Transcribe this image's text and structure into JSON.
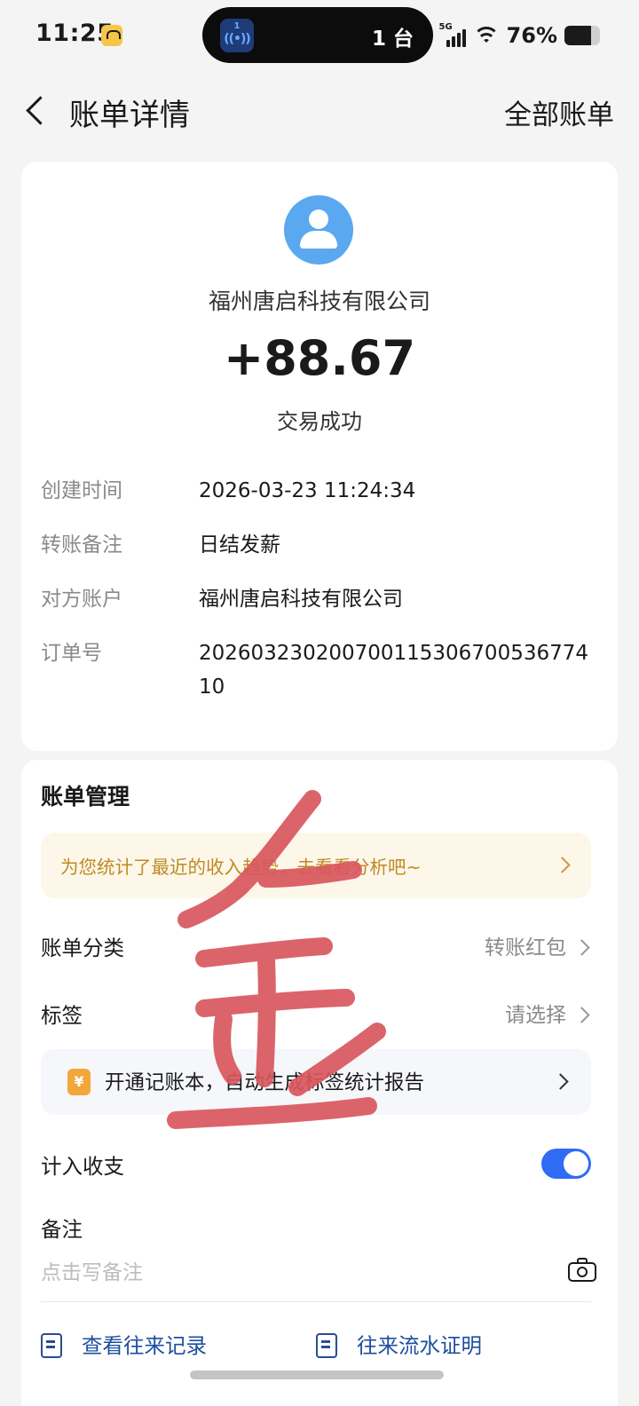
{
  "status_bar": {
    "time": "11:25",
    "island_label": "1 台",
    "network": "5G",
    "battery_pct": "76%",
    "battery_level": 0.76
  },
  "header": {
    "title": "账单详情",
    "right_link": "全部账单"
  },
  "detail": {
    "payer": "福州唐启科技有限公司",
    "amount": "+88.67",
    "status": "交易成功",
    "rows": [
      {
        "key": "创建时间",
        "value": "2026-03-23 11:24:34"
      },
      {
        "key": "转账备注",
        "value": "日结发薪"
      },
      {
        "key": "对方账户",
        "value": "福州唐启科技有限公司"
      },
      {
        "key": "订单号",
        "value": "20260323020070011530670053677410"
      }
    ]
  },
  "manage": {
    "title": "账单管理",
    "banner": "为您统计了最近的收入趋势，去看看分析吧~",
    "category_label": "账单分类",
    "category_value": "转账红包",
    "tag_label": "标签",
    "tag_value": "请选择",
    "promo": "开通记账本，自动生成标签统计报告",
    "coin_glyph": "¥",
    "include_label": "计入收支",
    "include_on": true,
    "note_label": "备注",
    "note_placeholder": "点击写备注",
    "link_history": "查看往来记录",
    "link_proof": "往来流水证明"
  },
  "colors": {
    "accent_blue": "#2f6cf3",
    "link_blue": "#1e4ea0",
    "banner_text": "#c08a22",
    "scribble_red": "#d9575e"
  }
}
